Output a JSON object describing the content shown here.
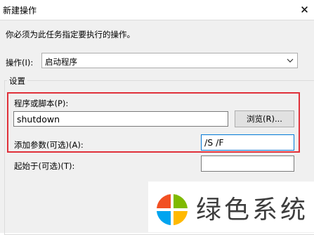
{
  "window": {
    "title": "新建操作",
    "close_glyph": "✕"
  },
  "instruction": "你必须为此任务指定要执行的操作。",
  "action": {
    "label": "操作(I):",
    "value": "启动程序"
  },
  "settings": {
    "legend": "设置",
    "program": {
      "label": "程序或脚本(P):",
      "value": "shutdown",
      "browse_label": "浏览(R)..."
    },
    "arguments": {
      "label": "添加参数(可选)(A):",
      "value": "/S /F"
    },
    "start_in": {
      "label": "起始于(可选)(T):",
      "value": ""
    }
  },
  "watermark": {
    "text": "绿色系统",
    "logo_colors": [
      "#f25022",
      "#7fba00",
      "#00a4ef",
      "#ffb900"
    ]
  },
  "colors": {
    "highlight_border": "#e0313a",
    "focus_border": "#0078d7",
    "dialog_bg": "#f0f0f0"
  }
}
